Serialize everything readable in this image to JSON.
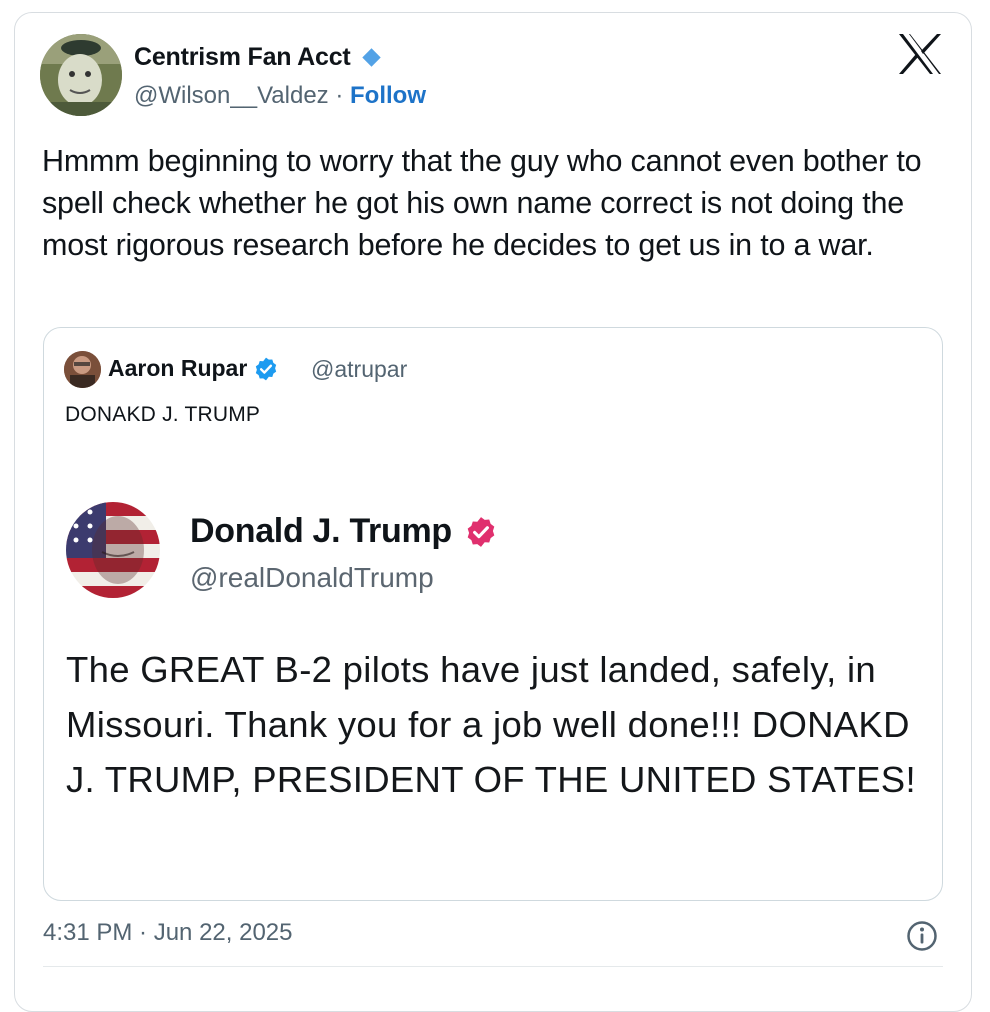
{
  "post": {
    "author_name": "Centrism Fan Acct",
    "handle": "@Wilson__Valdez",
    "separator": "·",
    "follow_label": "Follow",
    "text": "Hmmm beginning to worry that the guy who cannot even bother to spell check whether he got his own name correct is not doing the most rigorous research before he decides to get us in to a war.",
    "timestamp": "4:31 PM · Jun 22, 2025"
  },
  "quoted_post": {
    "author_name": "Aaron Rupar",
    "handle": "@atrupar",
    "text": "DONAKD J. TRUMP"
  },
  "embedded_post": {
    "author_name": "Donald J. Trump",
    "handle": "@realDonaldTrump",
    "text": "The GREAT B-2 pilots have just landed, safely, in Missouri. Thank you for a job well done!!! DONAKD J. TRUMP, PRESIDENT OF THE UNITED STATES!"
  },
  "icons": {
    "brand": "x-logo-icon",
    "verified_author": "diamond-verified-icon",
    "verified_quoted": "blue-check-badge-icon",
    "verified_embedded": "pink-check-badge-icon",
    "info": "info-icon"
  },
  "colors": {
    "follow": "#1d73c8",
    "secondary_text": "#536471",
    "verified_blue": "#1d9bf0",
    "verified_pink": "#e0306e",
    "diamond": "#53a2e6",
    "border": "#cfd9de"
  }
}
